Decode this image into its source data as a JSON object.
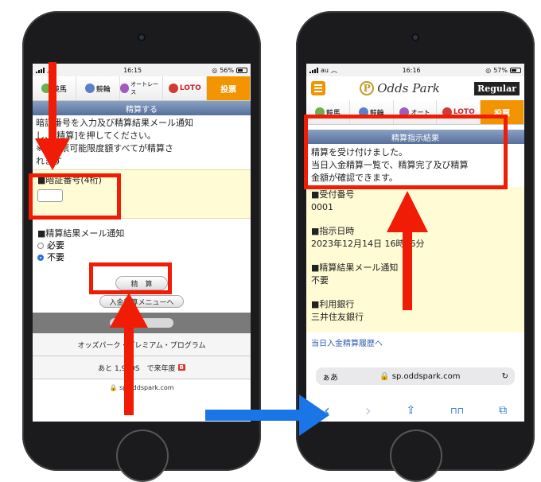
{
  "colors": {
    "highlight": "#f11c06",
    "blue_arrow": "#1a76e6",
    "vote_tab": "#f29400",
    "section_bar": "#56709c",
    "yellow_panel": "#fffbd5",
    "link": "#2d5bb5"
  },
  "left": {
    "status": {
      "time": "16:15",
      "battery": "56%"
    },
    "nav_tabs": [
      {
        "label": "競馬",
        "icon": "horse-racing-icon"
      },
      {
        "label": "競輪",
        "icon": "keirin-icon"
      },
      {
        "label": "オートレース",
        "icon": "auto-race-icon"
      },
      {
        "label": "LOTO",
        "icon": "loto-icon"
      },
      {
        "label": "投票",
        "icon": ""
      }
    ],
    "section_title": "精算する",
    "instructions": [
      "暗証番号を入力及び精算結果メール通知",
      "し、[精算]を押してください。",
      "※の投票可能限度額すべてが精算さ",
      "れます"
    ],
    "pin_label": "■暗証番号(4桁)",
    "mail_label": "■精算結果メール通知",
    "options": [
      {
        "label": "必要",
        "selected": false
      },
      {
        "label": "不要",
        "selected": true
      }
    ],
    "settle_button": "精　算",
    "back_button": "入金精算メニューへ",
    "program_row": "オッズパーク・プレミアム・プログラム",
    "points_row": "あと 1,990S　で来年度",
    "points_badge": "B",
    "url": "sp.oddspark.com"
  },
  "right": {
    "status": {
      "carrier": "au",
      "time": "16:16",
      "battery": "57%"
    },
    "logo": "Odds Park",
    "logo_mark": "P",
    "member_badge": "Regular",
    "nav_tabs": [
      {
        "label": "競馬"
      },
      {
        "label": "競輪"
      },
      {
        "label": "オート"
      },
      {
        "label": "LOTO"
      },
      {
        "label": "投票"
      }
    ],
    "section_title": "精算指示結果",
    "message": [
      "精算を受け付けました。",
      "当日入金精算一覧で、精算完了及び精算",
      "金額が確認できます。"
    ],
    "fields": [
      {
        "label": "■受付番号",
        "value": "0001"
      },
      {
        "label": "■指示日時",
        "value": "2023年12月14日 16時16分"
      },
      {
        "label": "■精算結果メール通知",
        "value": "不要"
      },
      {
        "label": "■利用銀行",
        "value": "三井住友銀行"
      }
    ],
    "history_link": "当日入金精算履歴へ",
    "address": {
      "prefix": "ぁあ",
      "url": "sp.oddspark.com",
      "lock_icon": "lock-icon",
      "reload_icon": "reload-icon"
    },
    "toolbar": [
      {
        "glyph": "‹",
        "icon": "back-icon"
      },
      {
        "glyph": "›",
        "icon": "forward-icon"
      },
      {
        "glyph": "⇪",
        "icon": "share-icon"
      },
      {
        "glyph": "⊓⊓",
        "icon": "bookmarks-icon"
      },
      {
        "glyph": "⧉",
        "icon": "tabs-icon"
      }
    ]
  }
}
